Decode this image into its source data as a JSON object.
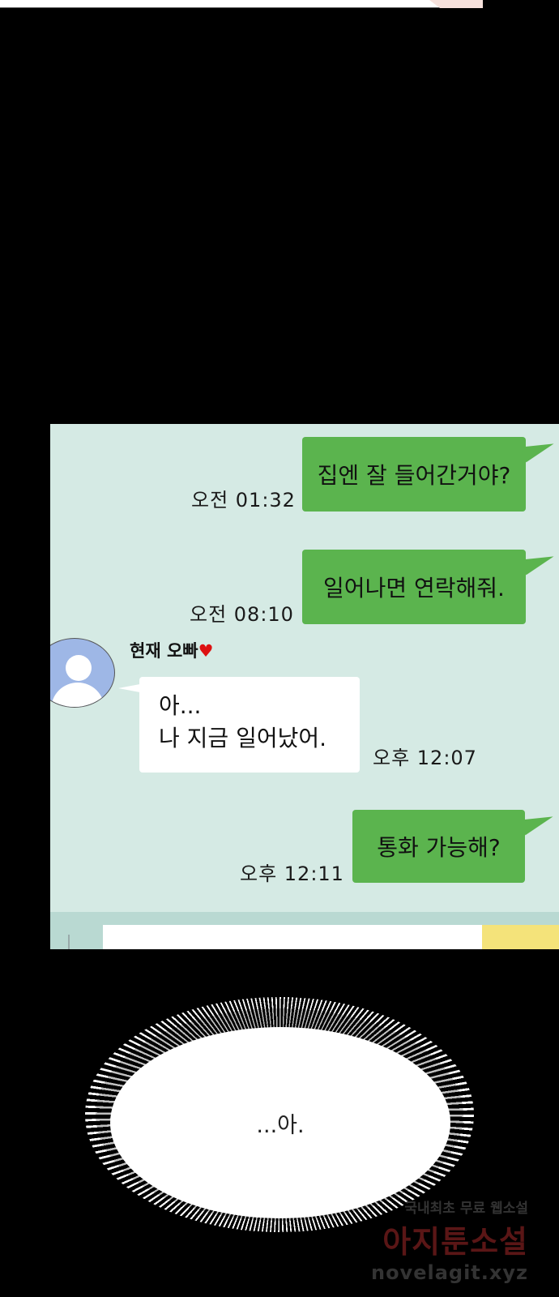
{
  "messages": {
    "out1": {
      "text": "집엔 잘 들어간거야?",
      "time": "오전  01:32"
    },
    "out2": {
      "text": "일어나면 연락해줘.",
      "time": "오전  08:10"
    },
    "in1": {
      "sender": "현재 오빠",
      "sender_heart": "♥",
      "line1": "아...",
      "line2": "나 지금 일어났어.",
      "time": "오후  12:07"
    },
    "out3": {
      "text": "통화 가능해?",
      "time": "오후  12:11"
    }
  },
  "balloon": {
    "text": "...아."
  },
  "watermark": {
    "tagline": "국내최초 무료 웹소설",
    "brand": "아지툰소설",
    "url": "novelagit.xyz"
  },
  "icons": {
    "avatar": "default-profile-icon",
    "emoji": "emoji-icon"
  },
  "colors": {
    "chat_bg": "#d5eae4",
    "outgoing_bubble": "#5bb44e",
    "incoming_bubble": "#ffffff",
    "page_bg": "#000000"
  }
}
